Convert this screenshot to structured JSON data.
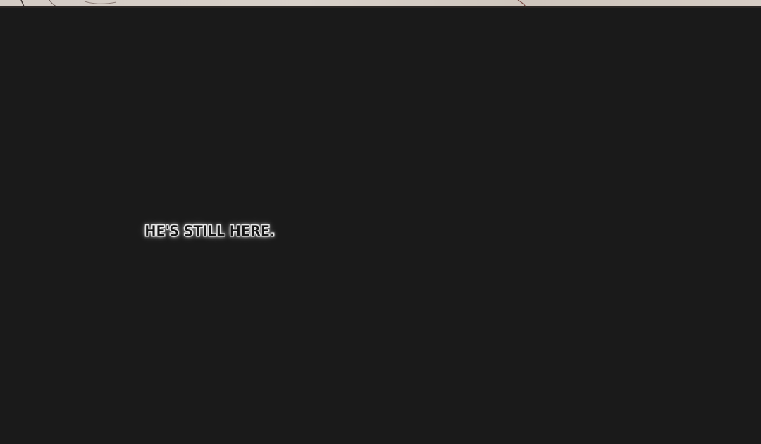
{
  "panel": {
    "caption": "HE'S STILL HERE."
  },
  "colors": {
    "background": "#1a1a1a",
    "top_panel": "#d6cdc5"
  }
}
